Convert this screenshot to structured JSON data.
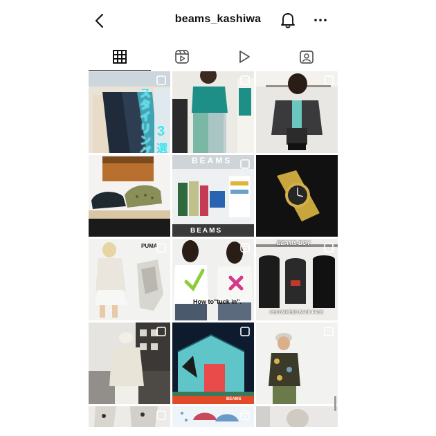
{
  "header": {
    "username": "beams_kashiwa",
    "back_icon": "chevron-left-icon",
    "bell_icon": "bell-icon",
    "more_icon": "more-horizontal-icon"
  },
  "tabs": [
    {
      "name": "posts",
      "icon": "grid-icon",
      "active": true
    },
    {
      "name": "reels",
      "icon": "reels-icon",
      "active": false
    },
    {
      "name": "videos",
      "icon": "play-icon",
      "active": false
    },
    {
      "name": "tagged",
      "icon": "tagged-person-icon",
      "active": false
    }
  ],
  "posts": [
    {
      "row": 1,
      "col": 1,
      "type": "carousel",
      "texts": [
        "スタイリング",
        "3",
        "選"
      ]
    },
    {
      "row": 1,
      "col": 2,
      "type": "carousel"
    },
    {
      "row": 1,
      "col": 3,
      "type": "carousel"
    },
    {
      "row": 2,
      "col": 1,
      "type": "photo"
    },
    {
      "row": 2,
      "col": 2,
      "type": "carousel",
      "texts": [
        "BEAMS",
        "BEAMS"
      ]
    },
    {
      "row": 2,
      "col": 3,
      "type": "photo"
    },
    {
      "row": 3,
      "col": 1,
      "type": "carousel",
      "texts": [
        "PUMA"
      ]
    },
    {
      "row": 3,
      "col": 2,
      "type": "reel",
      "texts": [
        "How to\"tuck in\"."
      ]
    },
    {
      "row": 3,
      "col": 3,
      "type": "carousel",
      "texts": [
        "BEAMS BOY",
        "RECOMMEND BACK PACK"
      ]
    },
    {
      "row": 4,
      "col": 1,
      "type": "carousel"
    },
    {
      "row": 4,
      "col": 2,
      "type": "carousel",
      "texts": [
        "BEAMS"
      ]
    },
    {
      "row": 4,
      "col": 3,
      "type": "carousel"
    },
    {
      "row": 5,
      "col": 1,
      "type": "carousel"
    },
    {
      "row": 5,
      "col": 2,
      "type": "reel"
    },
    {
      "row": 5,
      "col": 3,
      "type": "photo"
    }
  ],
  "colors": {
    "text": "#111111",
    "icon": "#262626",
    "badge": "#ffffff"
  }
}
